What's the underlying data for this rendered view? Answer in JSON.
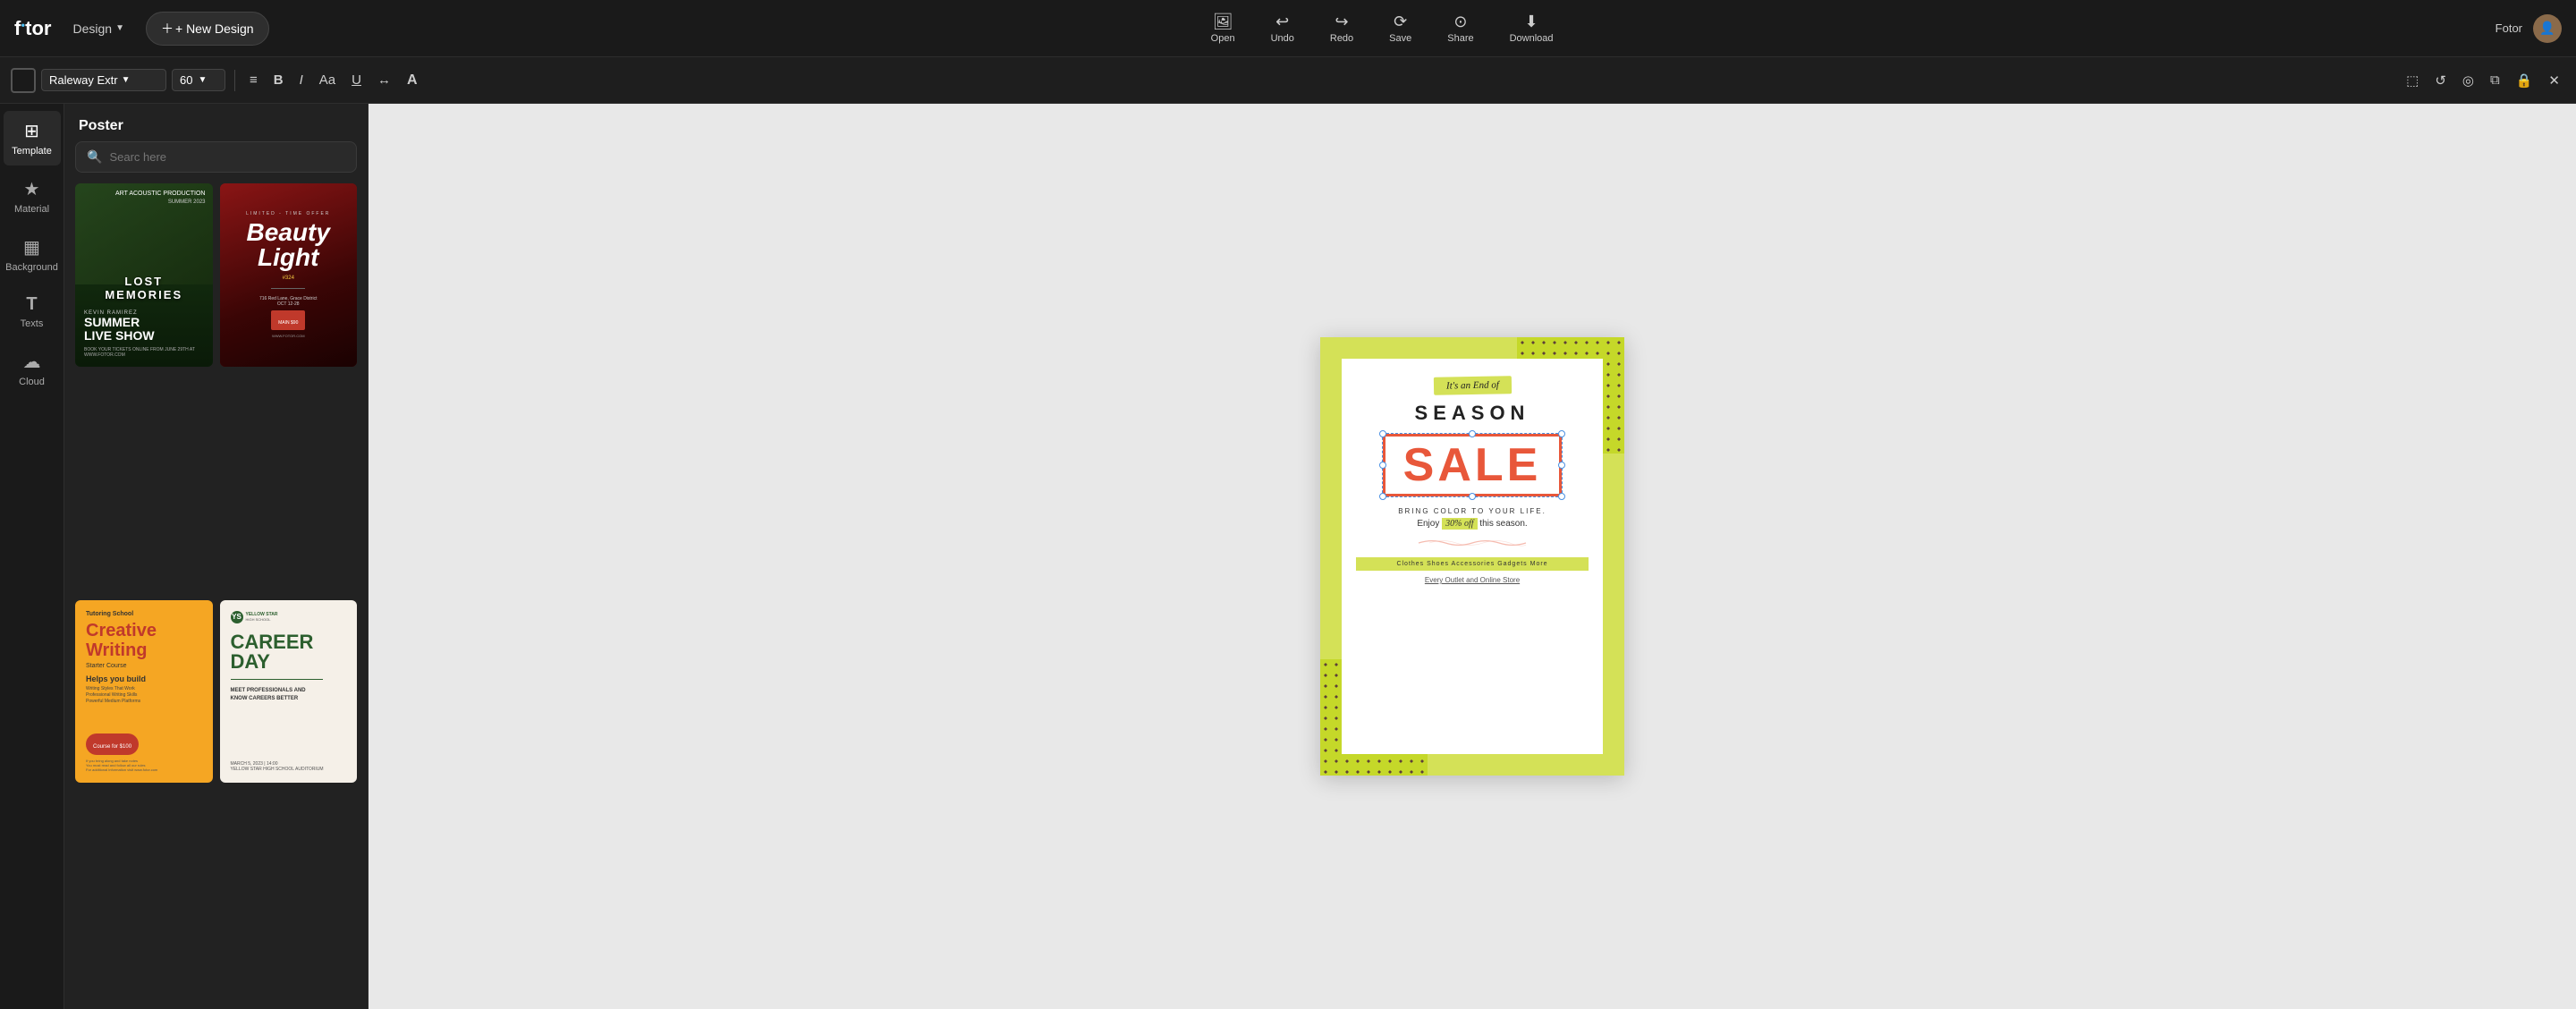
{
  "app": {
    "name": "Fotor",
    "user": "Fotor"
  },
  "topbar": {
    "design_label": "Design",
    "new_design_label": "+ New Design",
    "tools": [
      {
        "id": "open",
        "label": "Open",
        "icon": "🖼"
      },
      {
        "id": "undo",
        "label": "Undo",
        "icon": "↩"
      },
      {
        "id": "redo",
        "label": "Redo",
        "icon": "↪"
      },
      {
        "id": "save",
        "label": "Save",
        "icon": "⟳"
      },
      {
        "id": "share",
        "label": "Share",
        "icon": "⊙"
      },
      {
        "id": "download",
        "label": "Download",
        "icon": "⬇"
      }
    ]
  },
  "formatbar": {
    "font_name": "Raleway Extr",
    "font_size": "60",
    "align_icon": "≡",
    "bold_icon": "B",
    "italic_icon": "I",
    "size_aa_icon": "Aa",
    "underline_icon": "U",
    "spacing_icon": "↔",
    "case_icon": "A",
    "right_icons": [
      "⬜",
      "↺",
      "◎",
      "⧉",
      "🔒",
      "✕"
    ]
  },
  "sidebar": {
    "items": [
      {
        "id": "template",
        "label": "Template",
        "icon": "⊞"
      },
      {
        "id": "material",
        "label": "Material",
        "icon": "★"
      },
      {
        "id": "background",
        "label": "Background",
        "icon": "▦"
      },
      {
        "id": "texts",
        "label": "Texts",
        "icon": "T"
      },
      {
        "id": "cloud",
        "label": "Cloud",
        "icon": "☁"
      }
    ],
    "active": "template"
  },
  "panel": {
    "title": "Poster",
    "search_placeholder": "Searc here",
    "templates": [
      {
        "id": "tc1",
        "type": "concert",
        "label1": "SUMMER LIVE SHOW",
        "label2": "LOST MEMORIES",
        "sub": "KEVIN RAMIREZ"
      },
      {
        "id": "tc2",
        "type": "beauty",
        "label1": "Beauty Light",
        "sub": "#324"
      },
      {
        "id": "tc3",
        "type": "education",
        "label1": "Creative Writing",
        "label2": "Tutoring School",
        "sub": "Helps you build"
      },
      {
        "id": "tc4",
        "type": "career",
        "label1": "CAREER DAY",
        "label2": "YELLOW STAR HIGH SCHOOL",
        "sub": "MEET PROFESSIONALS AND KNOW CAREERS BETTER"
      }
    ]
  },
  "poster": {
    "tag": "It's an End of",
    "season": "SEASON",
    "sale": "SALE",
    "tagline": "BRING COLOR TO YOUR LIFE.",
    "enjoy": "Enjoy 30% off this season.",
    "strip": "Clothes  Shoes  Accessories  Gadgets  More",
    "store": "Every Outlet and Online Store"
  },
  "colors": {
    "topbar_bg": "#1a1a1a",
    "panel_bg": "#222222",
    "canvas_bg": "#e8e8e8",
    "accent": "#4a90e2",
    "poster_yellow": "#d4e157",
    "poster_red": "#e8573a"
  }
}
